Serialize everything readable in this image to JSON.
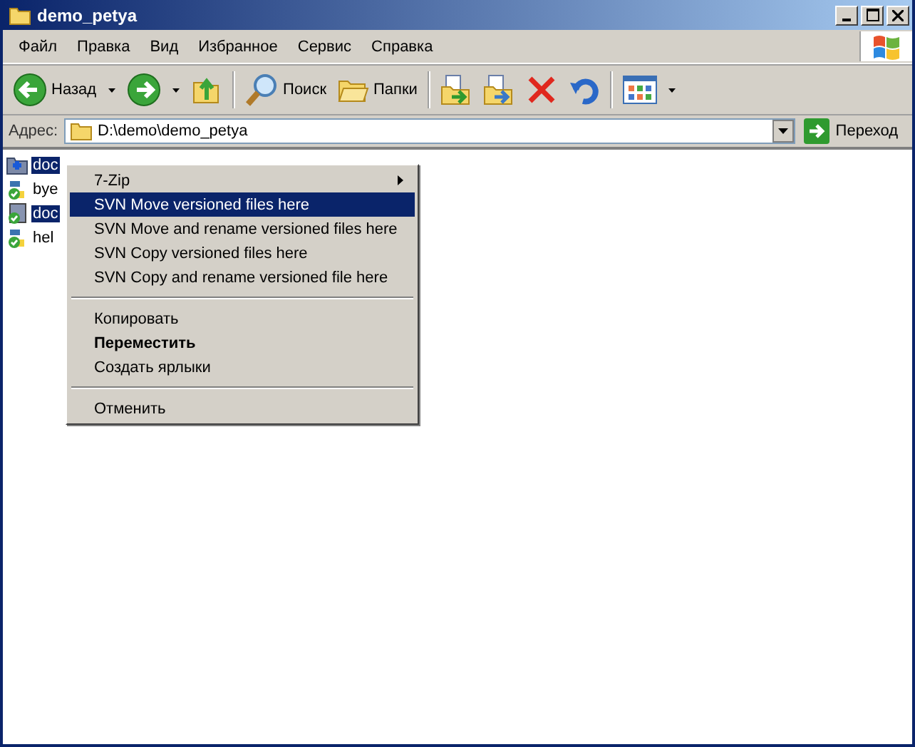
{
  "window": {
    "title": "demo_petya"
  },
  "menu_bar": [
    "Файл",
    "Правка",
    "Вид",
    "Избранное",
    "Сервис",
    "Справка"
  ],
  "toolbar": [
    {
      "kind": "back",
      "label": "Назад"
    },
    {
      "kind": "forward"
    },
    {
      "kind": "up"
    },
    {
      "kind": "search",
      "label": "Поиск"
    },
    {
      "kind": "folders",
      "label": "Папки"
    },
    {
      "kind": "move"
    },
    {
      "kind": "copy"
    },
    {
      "kind": "delete"
    },
    {
      "kind": "undo"
    },
    {
      "kind": "views"
    }
  ],
  "address_bar": {
    "label": "Адрес:",
    "value": "D:\\demo\\demo_petya",
    "go_label": "Переход"
  },
  "files": [
    {
      "name": "doc",
      "kind": "folder",
      "selected": true
    },
    {
      "name": "bye",
      "kind": "python",
      "selected": false
    },
    {
      "name": "doc",
      "kind": "document",
      "selected": true
    },
    {
      "name": "hel",
      "kind": "python",
      "selected": false
    }
  ],
  "context_menu": [
    {
      "kind": "submenu",
      "label": "7-Zip",
      "selected": false
    },
    {
      "kind": "item",
      "label": "SVN Move versioned files here",
      "selected": true
    },
    {
      "kind": "item",
      "label": "SVN Move and rename versioned files here",
      "selected": false
    },
    {
      "kind": "item",
      "label": "SVN Copy versioned files here",
      "selected": false
    },
    {
      "kind": "item",
      "label": "SVN Copy and rename versioned file here",
      "selected": false
    },
    {
      "kind": "separator"
    },
    {
      "kind": "item",
      "label": "Копировать",
      "selected": false
    },
    {
      "kind": "default",
      "label": "Переместить",
      "selected": false
    },
    {
      "kind": "item",
      "label": "Создать ярлыки",
      "selected": false
    },
    {
      "kind": "separator"
    },
    {
      "kind": "item",
      "label": "Отменить",
      "selected": false
    }
  ]
}
